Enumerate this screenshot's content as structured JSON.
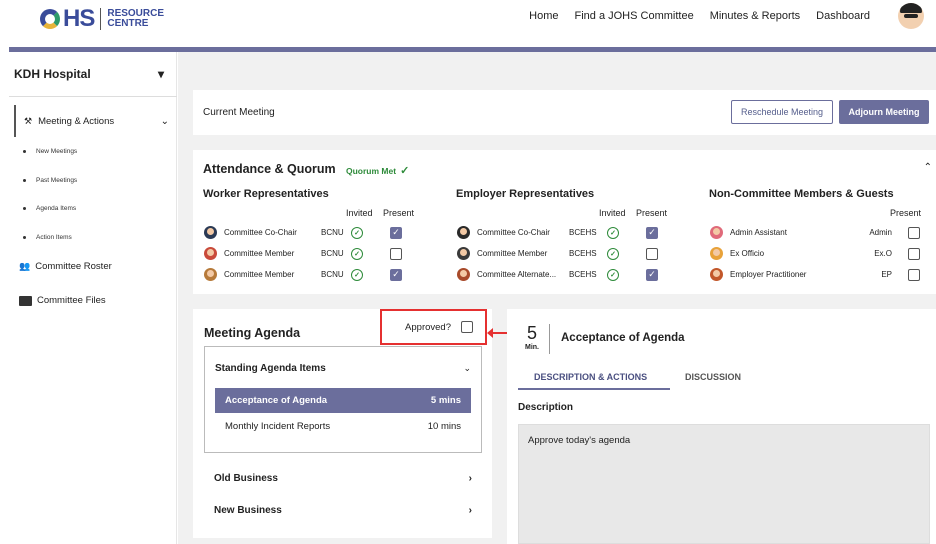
{
  "brand": {
    "logo_hs": "HS",
    "logo_line1": "RESOURCE",
    "logo_line2": "CENTRE"
  },
  "nav": {
    "items": [
      "Home",
      "Find a JOHS Committee",
      "Minutes & Reports",
      "Dashboard"
    ]
  },
  "sidebar": {
    "hospital": "KDH Hospital",
    "active": "Meeting & Actions",
    "sub_items": [
      "New Meetings",
      "Past Meetings",
      "Agenda Items",
      "Action Items"
    ],
    "items": [
      "Committee Roster",
      "Committee Files"
    ]
  },
  "current_meeting": {
    "title": "Current Meeting",
    "reschedule": "Reschedule Meeting",
    "adjourn": "Adjourn Meeting"
  },
  "attendance": {
    "title": "Attendance & Quorum",
    "quorum": "Quorum Met",
    "worker": {
      "title": "Worker Representatives",
      "invited": "Invited",
      "present": "Present",
      "rows": [
        {
          "role": "Committee Co-Chair",
          "org": "BCNU",
          "present": true,
          "avatar": "#2b3a55"
        },
        {
          "role": "Committee Member",
          "org": "BCNU",
          "present": false,
          "avatar": "#c94a3a"
        },
        {
          "role": "Committee Member",
          "org": "BCNU",
          "present": true,
          "avatar": "#b77a3a"
        }
      ]
    },
    "employer": {
      "title": "Employer Representatives",
      "invited": "Invited",
      "present": "Present",
      "rows": [
        {
          "role": "Committee Co-Chair",
          "org": "BCEHS",
          "present": true,
          "avatar": "#2a2a2a"
        },
        {
          "role": "Committee Member",
          "org": "BCEHS",
          "present": false,
          "avatar": "#3a3a3a"
        },
        {
          "role": "Committee Alternate...",
          "org": "BCEHS",
          "present": true,
          "avatar": "#a84a2a"
        }
      ]
    },
    "guests": {
      "title": "Non-Committee Members & Guests",
      "present": "Present",
      "rows": [
        {
          "role": "Admin Assistant",
          "code": "Admin",
          "present": false,
          "avatar": "#e06a7a"
        },
        {
          "role": "Ex Officio",
          "code": "Ex.O",
          "present": false,
          "avatar": "#e8a23a"
        },
        {
          "role": "Employer Practitioner",
          "code": "EP",
          "present": false,
          "avatar": "#c2572a"
        }
      ]
    }
  },
  "agenda": {
    "title": "Meeting Agenda",
    "approved": "Approved?",
    "standing": "Standing Agenda Items",
    "items": [
      {
        "name": "Acceptance of Agenda",
        "duration": "5 mins"
      },
      {
        "name": "Monthly Incident Reports",
        "duration": "10 mins"
      }
    ],
    "old_business": "Old Business",
    "new_business": "New Business"
  },
  "detail": {
    "minutes": "5",
    "minutes_unit": "Min.",
    "title": "Acceptance of Agenda",
    "tab_desc": "DESCRIPTION & ACTIONS",
    "tab_discussion": "DISCUSSION",
    "desc_label": "Description",
    "desc_text": "Approve today's agenda"
  }
}
